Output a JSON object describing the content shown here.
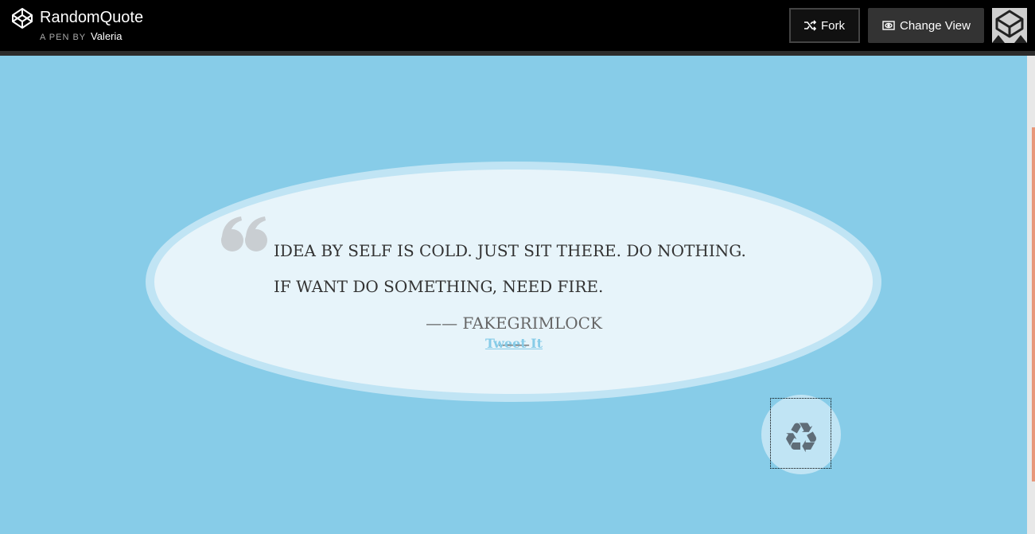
{
  "header": {
    "title": "RandomQuote",
    "pen_by_label": "A PEN BY",
    "author": "Valeria",
    "fork_label": "Fork",
    "change_view_label": "Change View",
    "logo_icon": "codepen-logo-icon",
    "fork_icon": "fork-icon",
    "view_icon": "eye-icon"
  },
  "quote": {
    "line1": "IDEA BY SELF IS COLD. JUST SIT THERE. DO NOTHING.",
    "line2": "IF WANT DO SOMETHING, NEED FIRE.",
    "author": "—— FAKEGRIMLOCK ——",
    "tweet_label": "Tweet It",
    "quote_icon": "quote-mark-icon",
    "new_quote_icon": "recycle-icon",
    "new_quote_glyph": "♻"
  },
  "colors": {
    "background": "#87cce8",
    "topbar": "#000000",
    "ellipse_border": "#c0e4f4",
    "ellipse_fill": "#e7f4fa",
    "tweet_link": "#87cce8",
    "scroll_thumb": "#e8977a"
  }
}
